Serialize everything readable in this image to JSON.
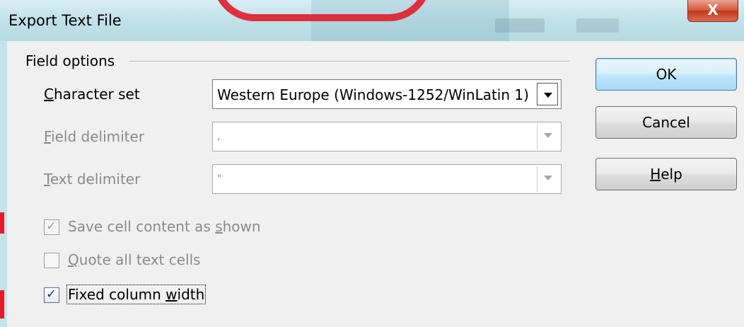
{
  "window": {
    "title": "Export Text File",
    "close_glyph": "X"
  },
  "field_options": {
    "group_label": "Field options",
    "character_set": {
      "label_underline": "C",
      "label_rest": "haracter set",
      "value": "Western Europe (Windows-1252/WinLatin 1)"
    },
    "field_delimiter": {
      "label_underline": "F",
      "label_rest": "ield delimiter",
      "value": ","
    },
    "text_delimiter": {
      "label_underline": "T",
      "label_rest": "ext delimiter",
      "value": "\""
    }
  },
  "options": {
    "save_cell_content": {
      "label_pre": "Save cell content as ",
      "label_underline": "s",
      "label_post": "hown",
      "checked": true,
      "enabled": false
    },
    "quote_all_text": {
      "label_pre": "",
      "label_underline": "Q",
      "label_post": "uote all text cells",
      "checked": false,
      "enabled": false
    },
    "fixed_column_width": {
      "label_pre": "Fixed column ",
      "label_underline": "w",
      "label_post": "idth",
      "checked": true,
      "enabled": true
    }
  },
  "buttons": {
    "ok": "OK",
    "cancel": "Cancel",
    "help_underline": "H",
    "help_rest": "elp"
  },
  "icons": {
    "check": "checkmark-icon",
    "dropdown": "chevron-down-icon",
    "close": "close-icon"
  },
  "colors": {
    "accent": "#e11d2c",
    "default_button": "#3c7fb1"
  }
}
